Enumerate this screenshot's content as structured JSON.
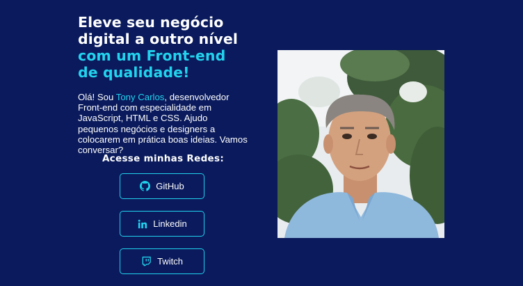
{
  "hero": {
    "headline_line1": "Eleve seu negócio",
    "headline_line2": "digital a outro nível",
    "headline_line3": "com um Front-end",
    "headline_line4": "de qualidade!",
    "intro_before": "Olá! Sou ",
    "intro_name": "Tony Carlos",
    "intro_after": ", desenvolvedor Front-end com especialidade em JavaScript, HTML e CSS. Ajudo pequenos negócios e designers a colocarem em prática boas ideias. Vamos conversar?"
  },
  "social": {
    "title": "Acesse minhas Redes:",
    "links": [
      {
        "label": "GitHub",
        "icon": "github-icon"
      },
      {
        "label": "Linkedin",
        "icon": "linkedin-icon"
      },
      {
        "label": "Twitch",
        "icon": "twitch-icon"
      }
    ]
  },
  "colors": {
    "background": "#0a1a5c",
    "accent": "#22d3ee",
    "text": "#ffffff"
  }
}
